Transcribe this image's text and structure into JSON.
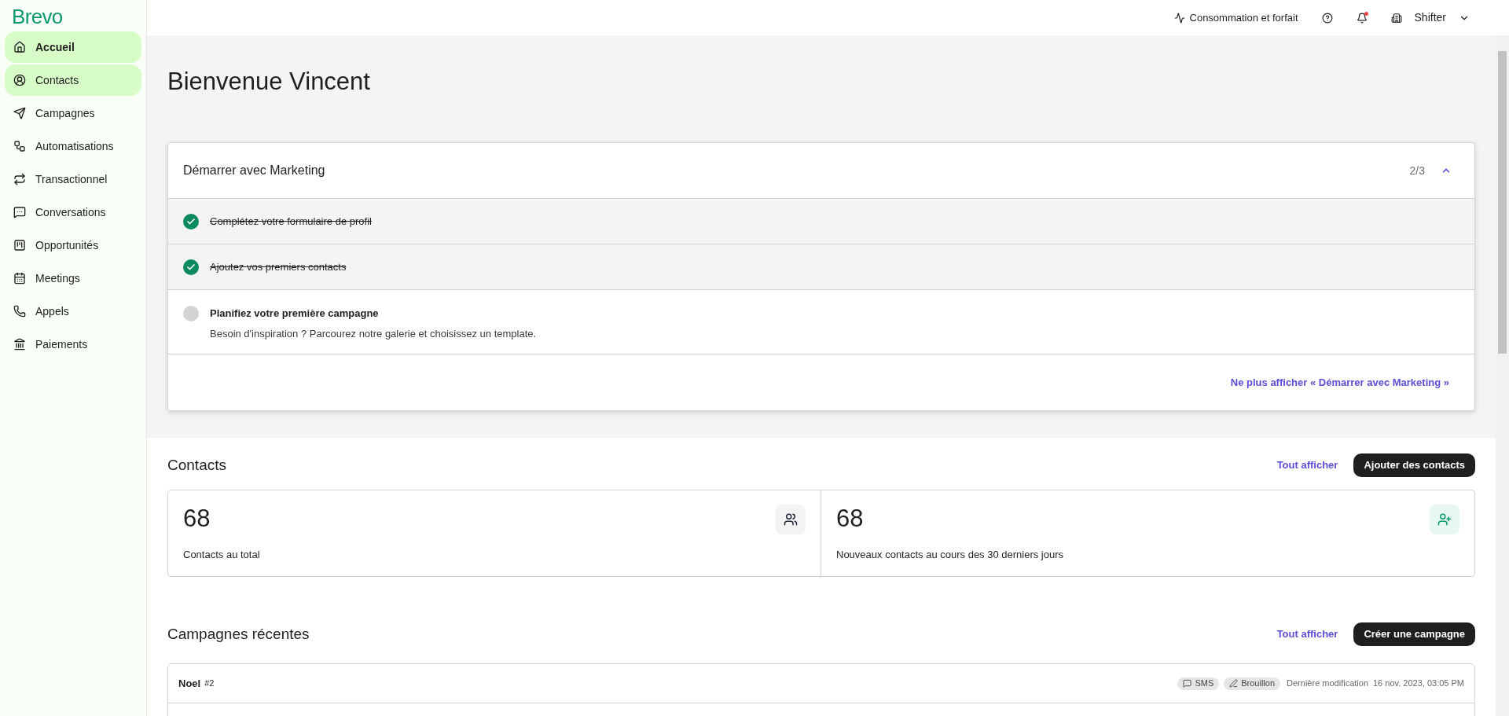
{
  "logo": "Brevo",
  "sidebar": {
    "items": [
      {
        "label": "Accueil",
        "selected": true,
        "hovered": false
      },
      {
        "label": "Contacts",
        "selected": false,
        "hovered": true
      },
      {
        "label": "Campagnes",
        "selected": false,
        "hovered": false
      },
      {
        "label": "Automatisations",
        "selected": false,
        "hovered": false
      },
      {
        "label": "Transactionnel",
        "selected": false,
        "hovered": false
      },
      {
        "label": "Conversations",
        "selected": false,
        "hovered": false
      },
      {
        "label": "Opportunités",
        "selected": false,
        "hovered": false
      },
      {
        "label": "Meetings",
        "selected": false,
        "hovered": false
      },
      {
        "label": "Appels",
        "selected": false,
        "hovered": false
      },
      {
        "label": "Paiements",
        "selected": false,
        "hovered": false
      }
    ]
  },
  "top_bar": {
    "usage": "Consommation et forfait",
    "notifications_unread": true,
    "account": "Shifter"
  },
  "title": "Bienvenue Vincent",
  "onboarding": {
    "title": "Démarrer avec Marketing",
    "progress": "2/3",
    "expanded": true,
    "steps": [
      {
        "title": "Complétez votre formulaire de profil",
        "checked": true
      },
      {
        "title": "Ajoutez vos premiers contacts",
        "checked": true
      },
      {
        "title": "Planifiez votre première campagne",
        "checked": false,
        "description": "Besoin d'inspiration ? Parcourez notre galerie et choisissez un template."
      }
    ],
    "dismiss": "Ne plus afficher « Démarrer avec Marketing »"
  },
  "contacts": {
    "title": "Contacts",
    "view_all": "Tout afficher",
    "action": "Ajouter des contacts",
    "stats": [
      {
        "value": "68",
        "label": "Contacts au total"
      },
      {
        "value": "68",
        "label": "Nouveaux contacts au cours des 30 derniers jours"
      }
    ]
  },
  "campaigns": {
    "title": "Campagnes récentes",
    "view_all": "Tout afficher",
    "action": "Créer une campagne",
    "rows": [
      {
        "name": "Noel",
        "number": "#2",
        "channel": "SMS",
        "status": "Brouillon",
        "modified_label": "Dernière modification",
        "modified": "16 nov. 2023, 03:05 PM"
      }
    ]
  }
}
